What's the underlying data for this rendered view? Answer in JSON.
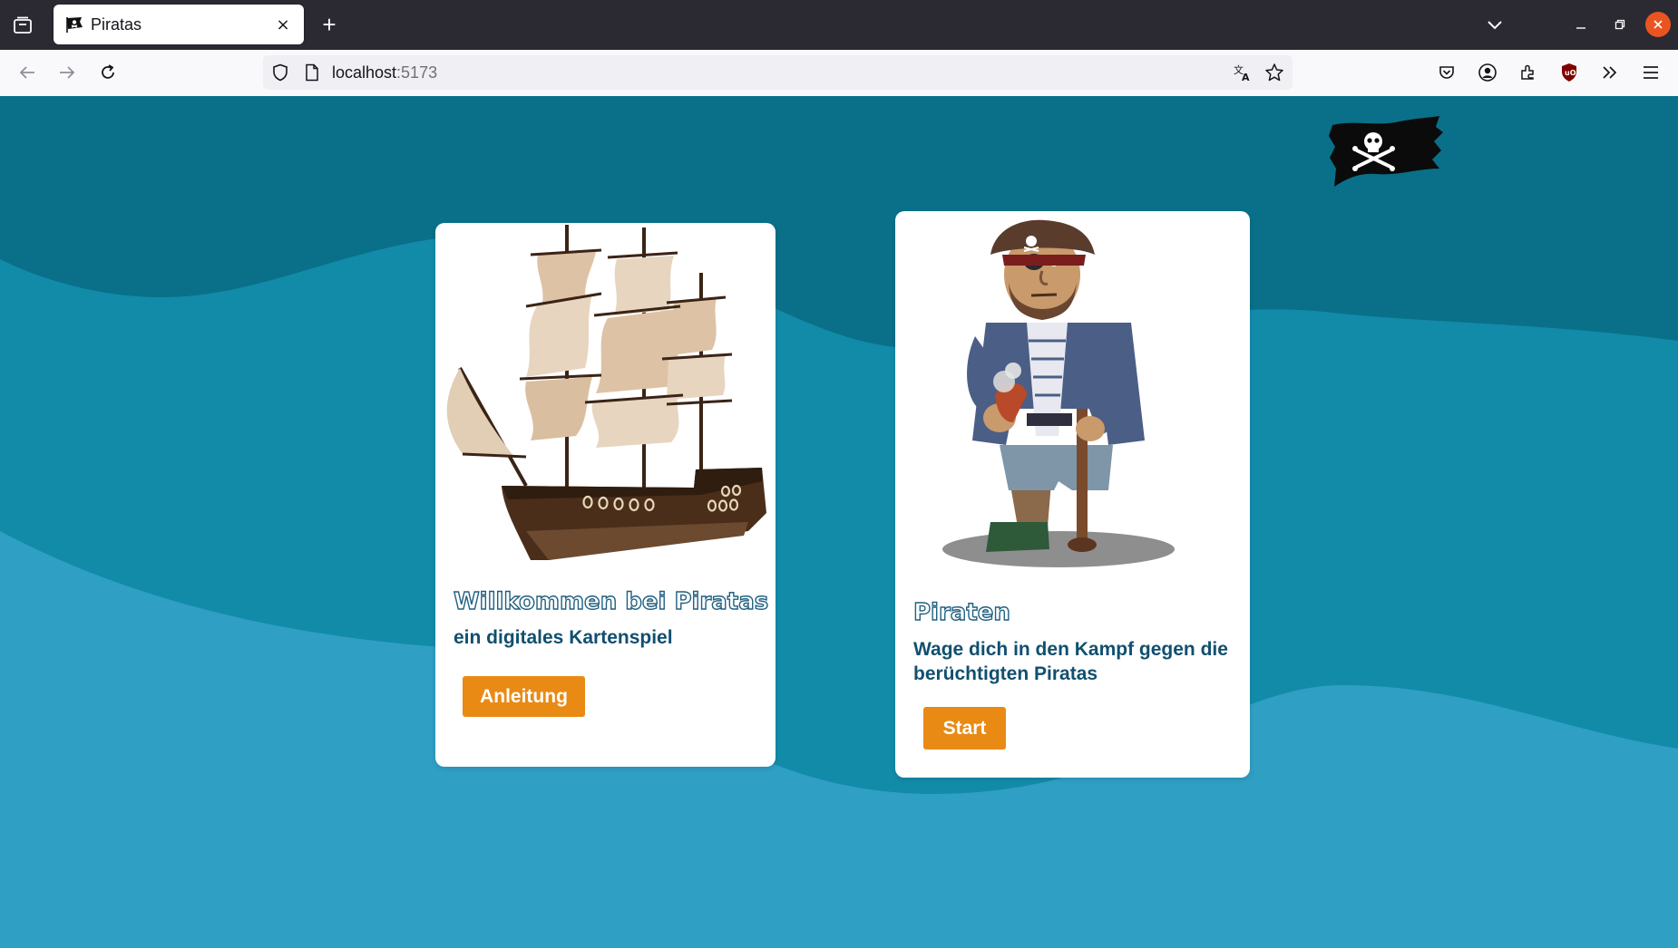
{
  "browser": {
    "tab_title": "Piratas",
    "tab_close": "×",
    "new_tab": "+",
    "url_host": "localhost",
    "url_port": ":5173"
  },
  "cards": {
    "welcome": {
      "title": "Willkommen bei Piratas",
      "subtitle": "ein digitales Kartenspiel",
      "button": "Anleitung"
    },
    "pirates": {
      "title": "Piraten",
      "subtitle": "Wage dich in den Kampf gegen die berüchtigten Piratas",
      "button": "Start"
    }
  },
  "colors": {
    "sea_dark": "#0a7089",
    "sea_mid": "#128ba9",
    "sea_light": "#2f9fc4",
    "button": "#e98a15",
    "heading": "#114f6f"
  },
  "icons": [
    "tab-list-icon",
    "pirate-flag-favicon",
    "close-icon",
    "plus-icon",
    "chevron-down-icon",
    "minimize-icon",
    "restore-icon",
    "window-close-icon",
    "back-icon",
    "forward-icon",
    "reload-icon",
    "shield-icon",
    "page-icon",
    "translate-icon",
    "star-icon",
    "pocket-icon",
    "account-icon",
    "extensions-icon",
    "ublock-icon",
    "overflow-icon",
    "menu-icon",
    "jolly-roger-flag-icon"
  ]
}
